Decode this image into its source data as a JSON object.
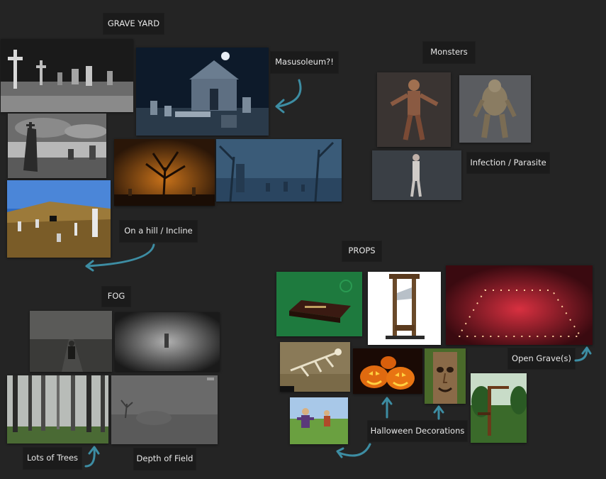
{
  "board": {
    "labels": {
      "graveyard": "GRAVE YARD",
      "mausoleum": "Masusoleum?!",
      "monsters": "Monsters",
      "infection": "Infection / Parasite",
      "hill": "On a hill / Incline",
      "props": "PROPS",
      "fog": "FOG",
      "open_grave": "Open Grave(s)",
      "halloween": "Halloween Decorations",
      "lots_of_trees": "Lots of Trees",
      "depth_of_field": "Depth of Field"
    },
    "colors": {
      "background": "#242424",
      "label_bg": "#1b1b1b",
      "label_text": "#e8e8e8",
      "arrow": "#3d8da3"
    }
  }
}
